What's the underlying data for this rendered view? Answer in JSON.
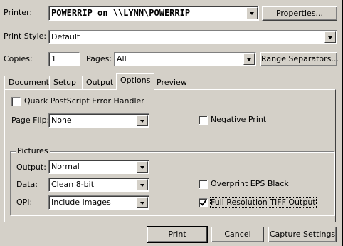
{
  "printer": {
    "label": "Printer:",
    "value": "POWERRIP on \\\\LYNN\\POWERRIP",
    "properties_button": "Properties..."
  },
  "print_style": {
    "label": "Print Style:",
    "value": "Default"
  },
  "copies": {
    "label": "Copies:",
    "value": "1"
  },
  "pages": {
    "label": "Pages:",
    "value": "All",
    "range_button": "Range Separators..."
  },
  "tabs": [
    {
      "label": "Document"
    },
    {
      "label": "Setup"
    },
    {
      "label": "Output"
    },
    {
      "label": "Options"
    },
    {
      "label": "Preview"
    }
  ],
  "active_tab": "Options",
  "options": {
    "quark_error_handler": {
      "label": "Quark PostScript Error Handler",
      "checked": false
    },
    "page_flip": {
      "label": "Page Flip:",
      "value": "None"
    },
    "negative_print": {
      "label": "Negative Print",
      "checked": false
    },
    "pictures": {
      "title": "Pictures",
      "output": {
        "label": "Output:",
        "value": "Normal"
      },
      "data": {
        "label": "Data:",
        "value": "Clean 8-bit"
      },
      "opi": {
        "label": "OPI:",
        "value": "Include Images"
      },
      "overprint_eps": {
        "label": "Overprint EPS Black",
        "checked": false
      },
      "full_res_tiff": {
        "label": "Full Resolution TIFF Output",
        "checked": true
      }
    }
  },
  "footer": {
    "print": "Print",
    "cancel": "Cancel",
    "capture": "Capture Settings"
  }
}
